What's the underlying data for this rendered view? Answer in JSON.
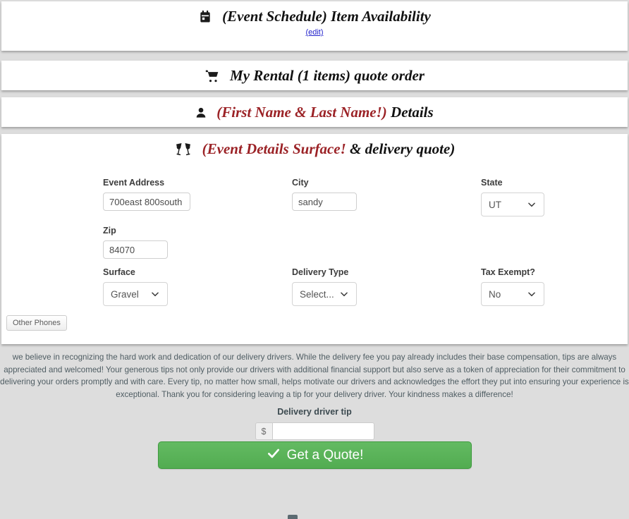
{
  "panels": {
    "schedule": {
      "icon": "calendar-icon",
      "title": "(Event Schedule) Item Availability",
      "edit_link": "(edit)"
    },
    "rental": {
      "icon": "shopping-cart-icon",
      "title": "My Rental (1 items) quote order"
    },
    "customer": {
      "icon": "user-icon",
      "title_accent": "(First Name & Last Name!)",
      "title_rest": " Details"
    },
    "details": {
      "icon": "cheers-glasses-icon",
      "title_accent": "(Event Details Surface!",
      "title_rest": " & delivery quote)"
    }
  },
  "form": {
    "address": {
      "label": "Event Address",
      "value": "700east 800south"
    },
    "city": {
      "label": "City",
      "value": "sandy"
    },
    "state": {
      "label": "State",
      "value": "UT"
    },
    "zip": {
      "label": "Zip",
      "value": "84070"
    },
    "surface": {
      "label": "Surface",
      "value": "Gravel"
    },
    "delivery_type": {
      "label": "Delivery Type",
      "value": "Select..."
    },
    "tax_exempt": {
      "label": "Tax Exempt?",
      "value": "No"
    },
    "other_phones_button": "Other Phones"
  },
  "tip": {
    "paragraph": "we believe in recognizing the hard work and dedication of our delivery drivers. While the delivery fee you pay already includes their base compensation, tips are always appreciated and welcomed! Your generous tips not only provide our drivers with additional financial support but also serve as a token of appreciation for their commitment to delivering your orders promptly and with care. Every tip, no matter how small, helps motivate our drivers and acknowledges the effort they put into ensuring your experience is exceptional. Thank you for considering leaving a tip for your delivery driver. Your kindness makes a difference!",
    "label": "Delivery driver tip",
    "currency_prefix": "$",
    "input_value": ""
  },
  "submit": {
    "label": "Get a Quote!",
    "icon": "check-icon",
    "color": "#52ac51"
  },
  "colors": {
    "background": "#dddddd",
    "panel": "#ffffff",
    "accent_red": "#9b2226",
    "link_blue": "#2222cc",
    "button_green": "#52ac51"
  }
}
